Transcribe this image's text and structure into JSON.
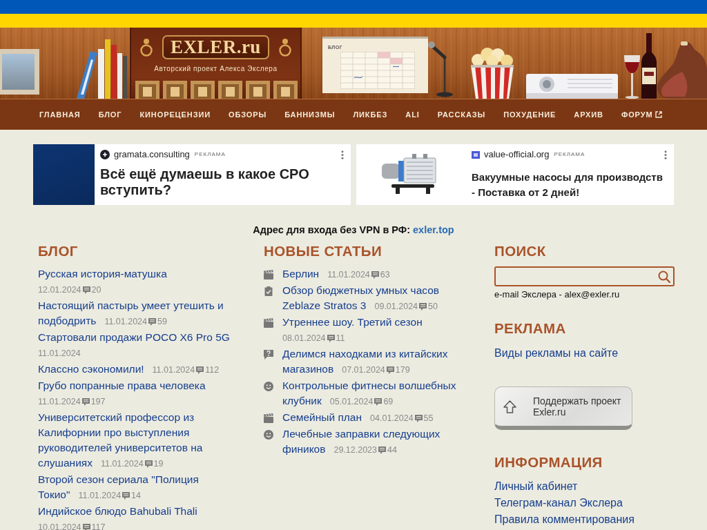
{
  "header": {
    "logo": "EXLER.ru",
    "tagline": "Авторский проект Алекса Экслера",
    "calendar_label": "БЛОГ"
  },
  "nav": [
    {
      "label": "ГЛАВНАЯ",
      "external": false
    },
    {
      "label": "БЛОГ",
      "external": false
    },
    {
      "label": "КИНОРЕЦЕНЗИИ",
      "external": false
    },
    {
      "label": "ОБЗОРЫ",
      "external": false
    },
    {
      "label": "БАННИЗМЫ",
      "external": false
    },
    {
      "label": "ЛИКБЕЗ",
      "external": false
    },
    {
      "label": "ALI",
      "external": false
    },
    {
      "label": "РАССКАЗЫ",
      "external": false
    },
    {
      "label": "ПОХУДЕНИЕ",
      "external": false
    },
    {
      "label": "АРХИВ",
      "external": false
    },
    {
      "label": "ФОРУМ",
      "external": true
    }
  ],
  "ads": [
    {
      "kind": "banner",
      "domain": "gramata.consulting",
      "badge": "РЕКЛАМА",
      "title": "Всё ещё думаешь в какое СРО вступить?"
    },
    {
      "kind": "product",
      "domain": "value-official.org",
      "badge": "РЕКЛАМА",
      "title": "Вакуумные насосы для производств - Поставка от 2 дней!"
    }
  ],
  "vpn_notice": {
    "text": "Адрес для входа без VPN в РФ:",
    "link": "exler.top"
  },
  "blog": {
    "title": "БЛОГ",
    "items": [
      {
        "title": "Русская история-матушка",
        "date": "12.01.2024",
        "comments": "20"
      },
      {
        "title": "Настоящий пастырь умеет утешить и подбодрить",
        "date": "11.01.2024",
        "comments": "59"
      },
      {
        "title": "Стартовали продажи POCO X6 Pro 5G",
        "date": "11.01.2024"
      },
      {
        "title": "Классно сэкономили!",
        "date": "11.01.2024",
        "comments": "112"
      },
      {
        "title": "Грубо попранные права человека",
        "date": "11.01.2024",
        "comments": "197"
      },
      {
        "title": "Университетский профессор из Калифорнии про выступления руководителей университетов на слушаниях",
        "date": "11.01.2024",
        "comments": "19"
      },
      {
        "title": "Второй сезон сериала \"Полиция Токио\"",
        "date": "11.01.2024",
        "comments": "14"
      },
      {
        "title": "Индийское блюдо Bahubali Thali",
        "date": "10.01.2024",
        "comments": "117"
      }
    ]
  },
  "new_articles": {
    "title": "НОВЫЕ СТАТЬИ",
    "items": [
      {
        "kind": "film",
        "title": "Берлин",
        "date": "11.01.2024",
        "comments": "63"
      },
      {
        "kind": "review",
        "title": "Обзор бюджетных умных часов Zeblaze Stratos 3",
        "date": "09.01.2024",
        "comments": "50"
      },
      {
        "kind": "film",
        "title": "Утреннее шоу. Третий сезон",
        "date": "08.01.2024",
        "comments": "11"
      },
      {
        "kind": "question",
        "title": "Делимся находками из китайских магазинов",
        "date": "07.01.2024",
        "comments": "179"
      },
      {
        "kind": "humor",
        "title": "Контрольные фитнесы волшебных клубник",
        "date": "05.01.2024",
        "comments": "69"
      },
      {
        "kind": "film",
        "title": "Семейный план",
        "date": "04.01.2024",
        "comments": "55"
      },
      {
        "kind": "humor",
        "title": "Лечебные заправки следующих фиников",
        "date": "29.12.2023",
        "comments": "44"
      }
    ]
  },
  "search": {
    "title": "ПОИСК",
    "contact": "e-mail Экслера - alex@exler.ru"
  },
  "advertising": {
    "title": "РЕКЛАМА",
    "link": "Виды рекламы на сайте"
  },
  "support_button": {
    "label": "Поддержать проект Exler.ru"
  },
  "info": {
    "title": "ИНФОРМАЦИЯ",
    "links": [
      "Личный кабинет",
      "Телеграм-канал Экслера",
      "Правила комментирования"
    ]
  }
}
